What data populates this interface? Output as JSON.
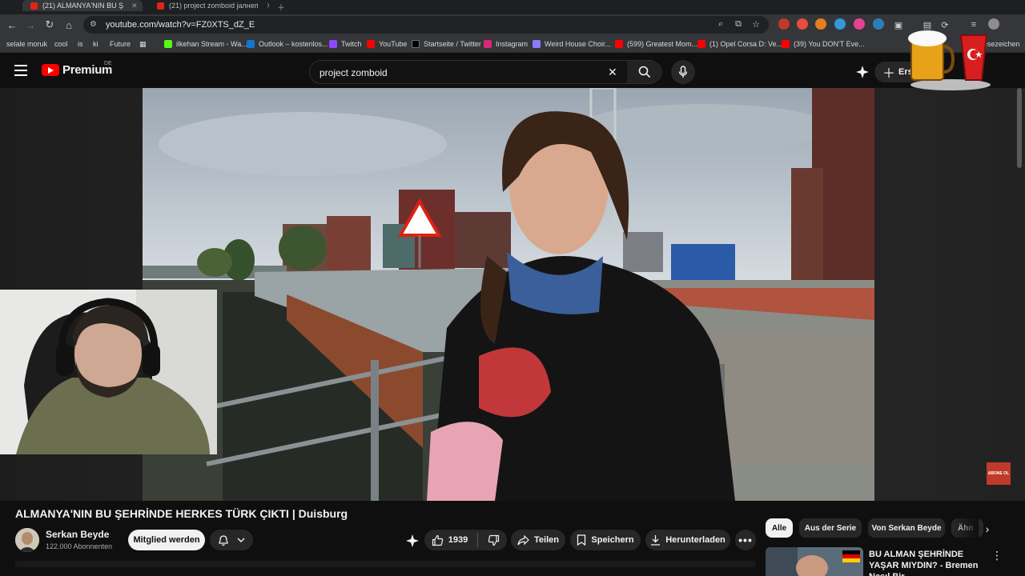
{
  "browser": {
    "tabs": [
      {
        "title": "(21) ALMANYA'NIN BU Ş"
      },
      {
        "title": "(21) project zomboid јалнеп"
      }
    ],
    "url": "youtube.com/watch?v=FZ0XTS_dZ_E",
    "bookmarks": [
      {
        "label": "selale moruk",
        "color": "#6b6b6b"
      },
      {
        "label": "cool",
        "color": "#6b6b6b"
      },
      {
        "label": "is",
        "color": "#6b6b6b"
      },
      {
        "label": "ki",
        "color": "#6b6b6b"
      },
      {
        "label": "Future",
        "color": "#6b6b6b"
      },
      {
        "label": "ilkehan Stream - Wa...",
        "color": "#53fc18"
      },
      {
        "label": "Outlook – kostenlos...",
        "color": "#0f78d4"
      },
      {
        "label": "Twitch",
        "color": "#9146ff"
      },
      {
        "label": "YouTube",
        "color": "#ff0000"
      },
      {
        "label": "Startseite / Twitter",
        "color": "#000000"
      },
      {
        "label": "Instagram",
        "color": "#d62976"
      },
      {
        "label": "Weird House Choir...",
        "color": "#8a7cff"
      },
      {
        "label": "(599) Greatest Mom...",
        "color": "#ff0000"
      },
      {
        "label": "(1) Opel Corsa D: Ve...",
        "color": "#ff0000"
      },
      {
        "label": "(39) You DON'T Eve...",
        "color": "#ff0000"
      },
      {
        "label": "esezeichen",
        "color": "#6b6b6b"
      }
    ]
  },
  "youtube": {
    "logo_text": "Premium",
    "region": "DE",
    "search_value": "project zomboid",
    "create_label": "Erst"
  },
  "video": {
    "title": "ALMANYA'NIN BU ŞEHRİNDE HERKES TÜRK ÇIKTI | Duisburg",
    "channel": "Serkan Beyde",
    "subscribers": "122.000 Abonnenten",
    "join_label": "Mitglied werden",
    "likes": "1939",
    "share_label": "Teilen",
    "save_label": "Speichern",
    "download_label": "Herunterladen",
    "overlay_badge": "ABONE OL"
  },
  "chips": [
    "Alle",
    "Aus der Serie",
    "Von Serkan Beyde",
    "Ähn"
  ],
  "recommendation": {
    "title": "BU ALMAN ŞEHRİNDE YAŞAR MIYDIN? - Bremen Nasıl Bir..."
  },
  "colors": {
    "brand_red": "#ff0000",
    "background": "#0f0f0f",
    "chip_selected": "#f1f1f1"
  }
}
